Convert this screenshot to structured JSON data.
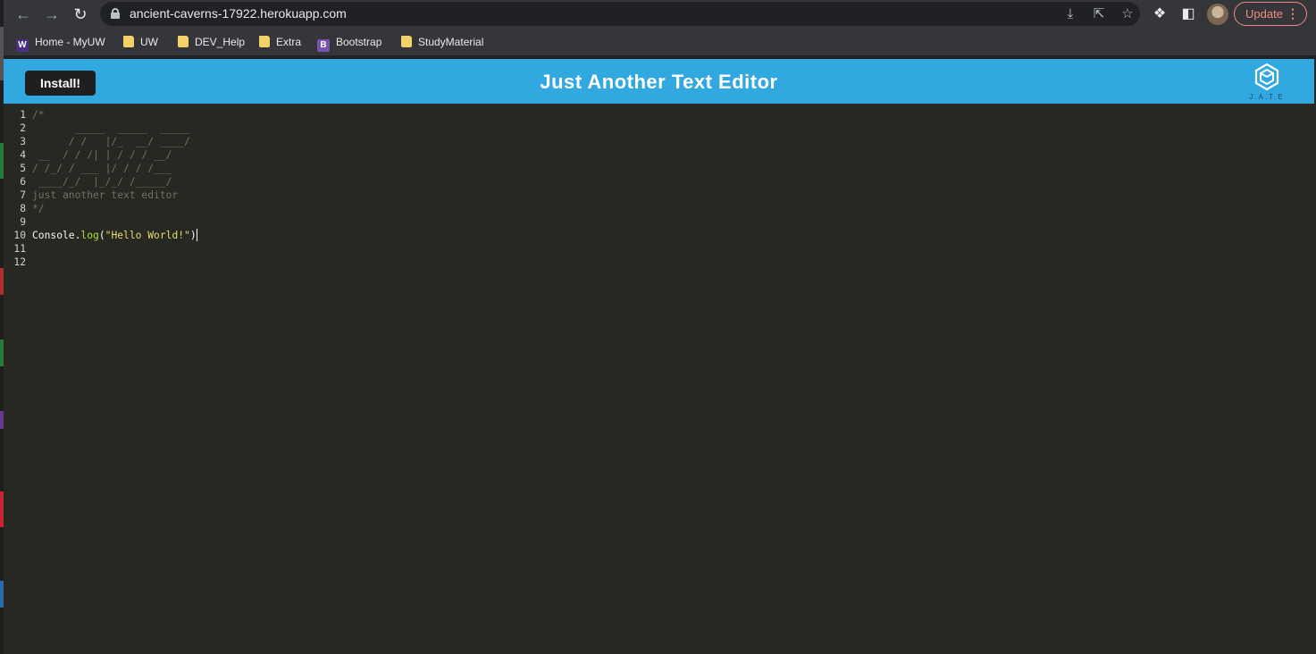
{
  "browser": {
    "url": "ancient-caverns-17922.herokuapp.com",
    "update_label": "Update",
    "bookmarks": [
      {
        "label": "Home - MyUW",
        "icon": "uw-w-icon"
      },
      {
        "label": "UW",
        "icon": "folder-icon"
      },
      {
        "label": "DEV_Help",
        "icon": "folder-icon"
      },
      {
        "label": "Extra",
        "icon": "folder-icon"
      },
      {
        "label": "Bootstrap",
        "icon": "bootstrap-b-icon"
      },
      {
        "label": "StudyMaterial",
        "icon": "folder-icon"
      }
    ]
  },
  "app": {
    "install_label": "Install!",
    "title": "Just Another Text Editor",
    "logo_text": "J.A.T.E",
    "accent_color": "#31a8df"
  },
  "editor": {
    "lines": [
      {
        "n": "1",
        "text": "/*"
      },
      {
        "n": "2",
        "text": "       _____  _____  _____"
      },
      {
        "n": "3",
        "text": "      / /   |/_  __/ ____/"
      },
      {
        "n": "4",
        "text": " __  / / /| | / / / __/"
      },
      {
        "n": "5",
        "text": "/ /_/ / ___ |/ / / /___"
      },
      {
        "n": "6",
        "text": " ____/_/  |_/_/ /_____/"
      },
      {
        "n": "7",
        "text": "just another text editor"
      },
      {
        "n": "8",
        "text": "*/"
      },
      {
        "n": "9",
        "text": ""
      },
      {
        "n": "10",
        "text": "",
        "code": {
          "obj": "Console",
          "dot": ".",
          "method": "log",
          "open": "(",
          "str": "\"Hello World!\"",
          "close": ")"
        }
      },
      {
        "n": "11",
        "text": ""
      },
      {
        "n": "12",
        "text": ""
      }
    ]
  }
}
